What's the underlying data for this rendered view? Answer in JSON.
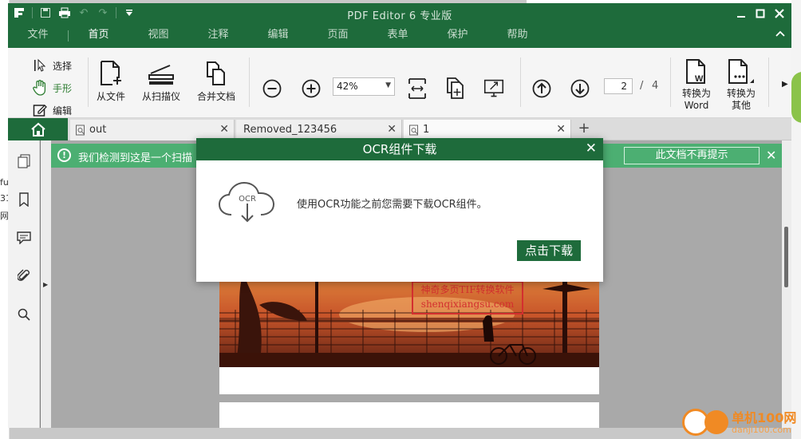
{
  "window": {
    "title": "PDF Editor 6 专业版"
  },
  "menu": {
    "tabs": [
      "文件",
      "首页",
      "视图",
      "注释",
      "编辑",
      "页面",
      "表单",
      "保护",
      "帮助"
    ],
    "active": "首页"
  },
  "ribbon": {
    "tools": {
      "select": "选择",
      "hand": "手形",
      "edit": "编辑"
    },
    "from_file": "从文件",
    "from_scanner": "从扫描仪",
    "merge": "合并文档",
    "zoom_value": "42%",
    "page_current": "2",
    "page_sep": "/",
    "page_total": "4",
    "to_word": [
      "转换为",
      "Word"
    ],
    "to_other": [
      "转换为",
      "其他"
    ]
  },
  "doc_tabs": [
    {
      "label": "out"
    },
    {
      "label": "Removed_123456"
    },
    {
      "label": "1"
    }
  ],
  "notice": {
    "text": "我们检测到这是一个扫描",
    "dismiss": "此文档不再提示"
  },
  "modal": {
    "title": "OCR组件下载",
    "icon_label": "OCR",
    "message": "使用OCR功能之前您需要下载OCR组件。",
    "button": "点击下载"
  },
  "document": {
    "stamp_line1": "神奇多页TIF转换软件",
    "stamp_line2": "shenqixiangsu.com"
  },
  "watermark": {
    "brand": "单机100网",
    "url": "danji100.com"
  },
  "desktop": {
    "left_fragments": [
      "ful",
      "31(",
      "网"
    ]
  },
  "colors": {
    "brand_green": "#1e6b3b",
    "notice_green": "#4caf72",
    "accent_orange": "#f08a24"
  }
}
